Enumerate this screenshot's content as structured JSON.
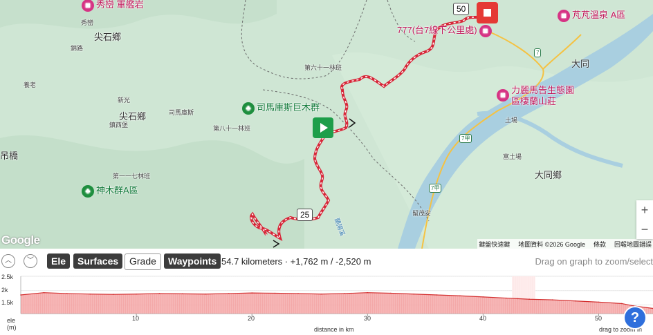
{
  "map": {
    "poi": {
      "xiuluan": "秀巒 軍艦岩",
      "xiuluan_small": "秀巒",
      "jianshi_village_top": "尖石鄉",
      "jinlu": "錦路",
      "guilao": "養老",
      "xinguang": "新光",
      "jianshi_village": "尖石鄉",
      "zhenxibao": "鎮西堡",
      "simakusi_small": "司馬庫斯",
      "simakusi_trees": "司馬庫斯巨木群",
      "forest_61": "第六十一林班",
      "forest_81": "第八十一林班",
      "forest_117": "第一一七林班",
      "shenmuqun": "神木群A區",
      "diaoqiao": "吊橋",
      "km777": "777(台7線下公里處)",
      "fanfan": "芃芃溫泉 A區",
      "datong": "大同",
      "lilimagao": "力麗馬告生態園區棲蘭山莊",
      "tuchang": "土場",
      "xiatuchang": "富土場",
      "datong_village": "大同鄉",
      "liumaoan": "留茂安",
      "lanyangxi": "蘭陽溪"
    },
    "route_shields": [
      "7",
      "7甲",
      "7甲"
    ],
    "km_flags": [
      "50",
      "25"
    ],
    "google_logo": "Google",
    "attribution": {
      "shortcuts": "鍵盤快速鍵",
      "map_data": "地圖資料 ©2026 Google",
      "terms": "條款",
      "report": "回報地圖錯誤"
    },
    "zoom": {
      "in": "+",
      "out": "−"
    }
  },
  "toolbar": {
    "collapse_up": "︿",
    "collapse_down": "﹀",
    "tabs": [
      {
        "label": "Ele",
        "active": true
      },
      {
        "label": "Surfaces",
        "active": true
      },
      {
        "label": "Grade",
        "active": false
      },
      {
        "label": "Waypoints",
        "active": true
      }
    ],
    "stats": "54.7 kilometers · +1,762 m / -2,520 m",
    "hint": "Drag on graph to zoom/select"
  },
  "chart_data": {
    "type": "area",
    "title": "",
    "xlabel": "distance in km",
    "ylabel": "ele (m)",
    "y_tick_labels": [
      "2.5k",
      "2k",
      "1.5k"
    ],
    "x_tick_labels": [
      "10",
      "20",
      "30",
      "40",
      "50"
    ],
    "xlim": [
      0,
      54.7
    ],
    "ylim": [
      1200,
      2500
    ],
    "x": [
      0,
      2,
      4,
      6,
      8,
      10,
      12,
      14,
      16,
      18,
      20,
      22,
      24,
      26,
      28,
      30,
      32,
      34,
      36,
      38,
      40,
      42,
      43,
      44,
      46,
      48,
      50,
      52,
      53,
      54.7
    ],
    "y": [
      1850,
      1930,
      1900,
      1880,
      1870,
      1880,
      1900,
      1890,
      1880,
      1900,
      1920,
      1910,
      1900,
      1880,
      1900,
      1930,
      1910,
      1880,
      1850,
      1820,
      1780,
      1740,
      1720,
      1700,
      1680,
      1640,
      1600,
      1550,
      1470,
      1380
    ],
    "fill_color": "#f29a9a",
    "line_color": "#d32f2f",
    "highlight_range_km": [
      42.5,
      44.5
    ]
  },
  "graph": {
    "bottom_right_hint": "drag to zoom in",
    "help": "?"
  }
}
